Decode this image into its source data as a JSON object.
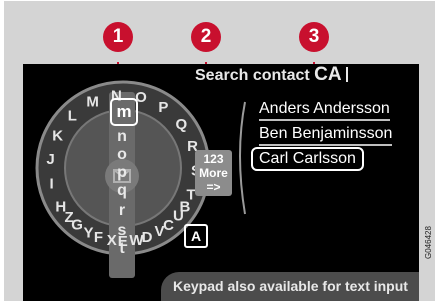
{
  "callouts": [
    "1",
    "2",
    "3"
  ],
  "screen": {
    "title_label": "Search contact",
    "query": "CA",
    "wheel_letters": [
      "A",
      "B",
      "C",
      "D",
      "E",
      "F",
      "G",
      "H",
      "I",
      "J",
      "K",
      "L",
      "M",
      "N",
      "O",
      "P",
      "Q",
      "R",
      "S",
      "T",
      "U",
      "V",
      "W",
      "X",
      "Y",
      "Z"
    ],
    "letter_strip": [
      "m",
      "n",
      "o",
      "p",
      "q",
      "r",
      "s",
      "t"
    ],
    "side_options": [
      "123",
      "More",
      "=>"
    ],
    "a_key": "A",
    "contacts": [
      "Anders Andersson",
      "Ben Benjaminsson",
      "Carl Carlsson"
    ],
    "hint": "Keypad also available for text input",
    "accent_color": "#c8102e",
    "icons": {
      "center": "phonebook-icon"
    }
  },
  "figure_code": "G046428"
}
